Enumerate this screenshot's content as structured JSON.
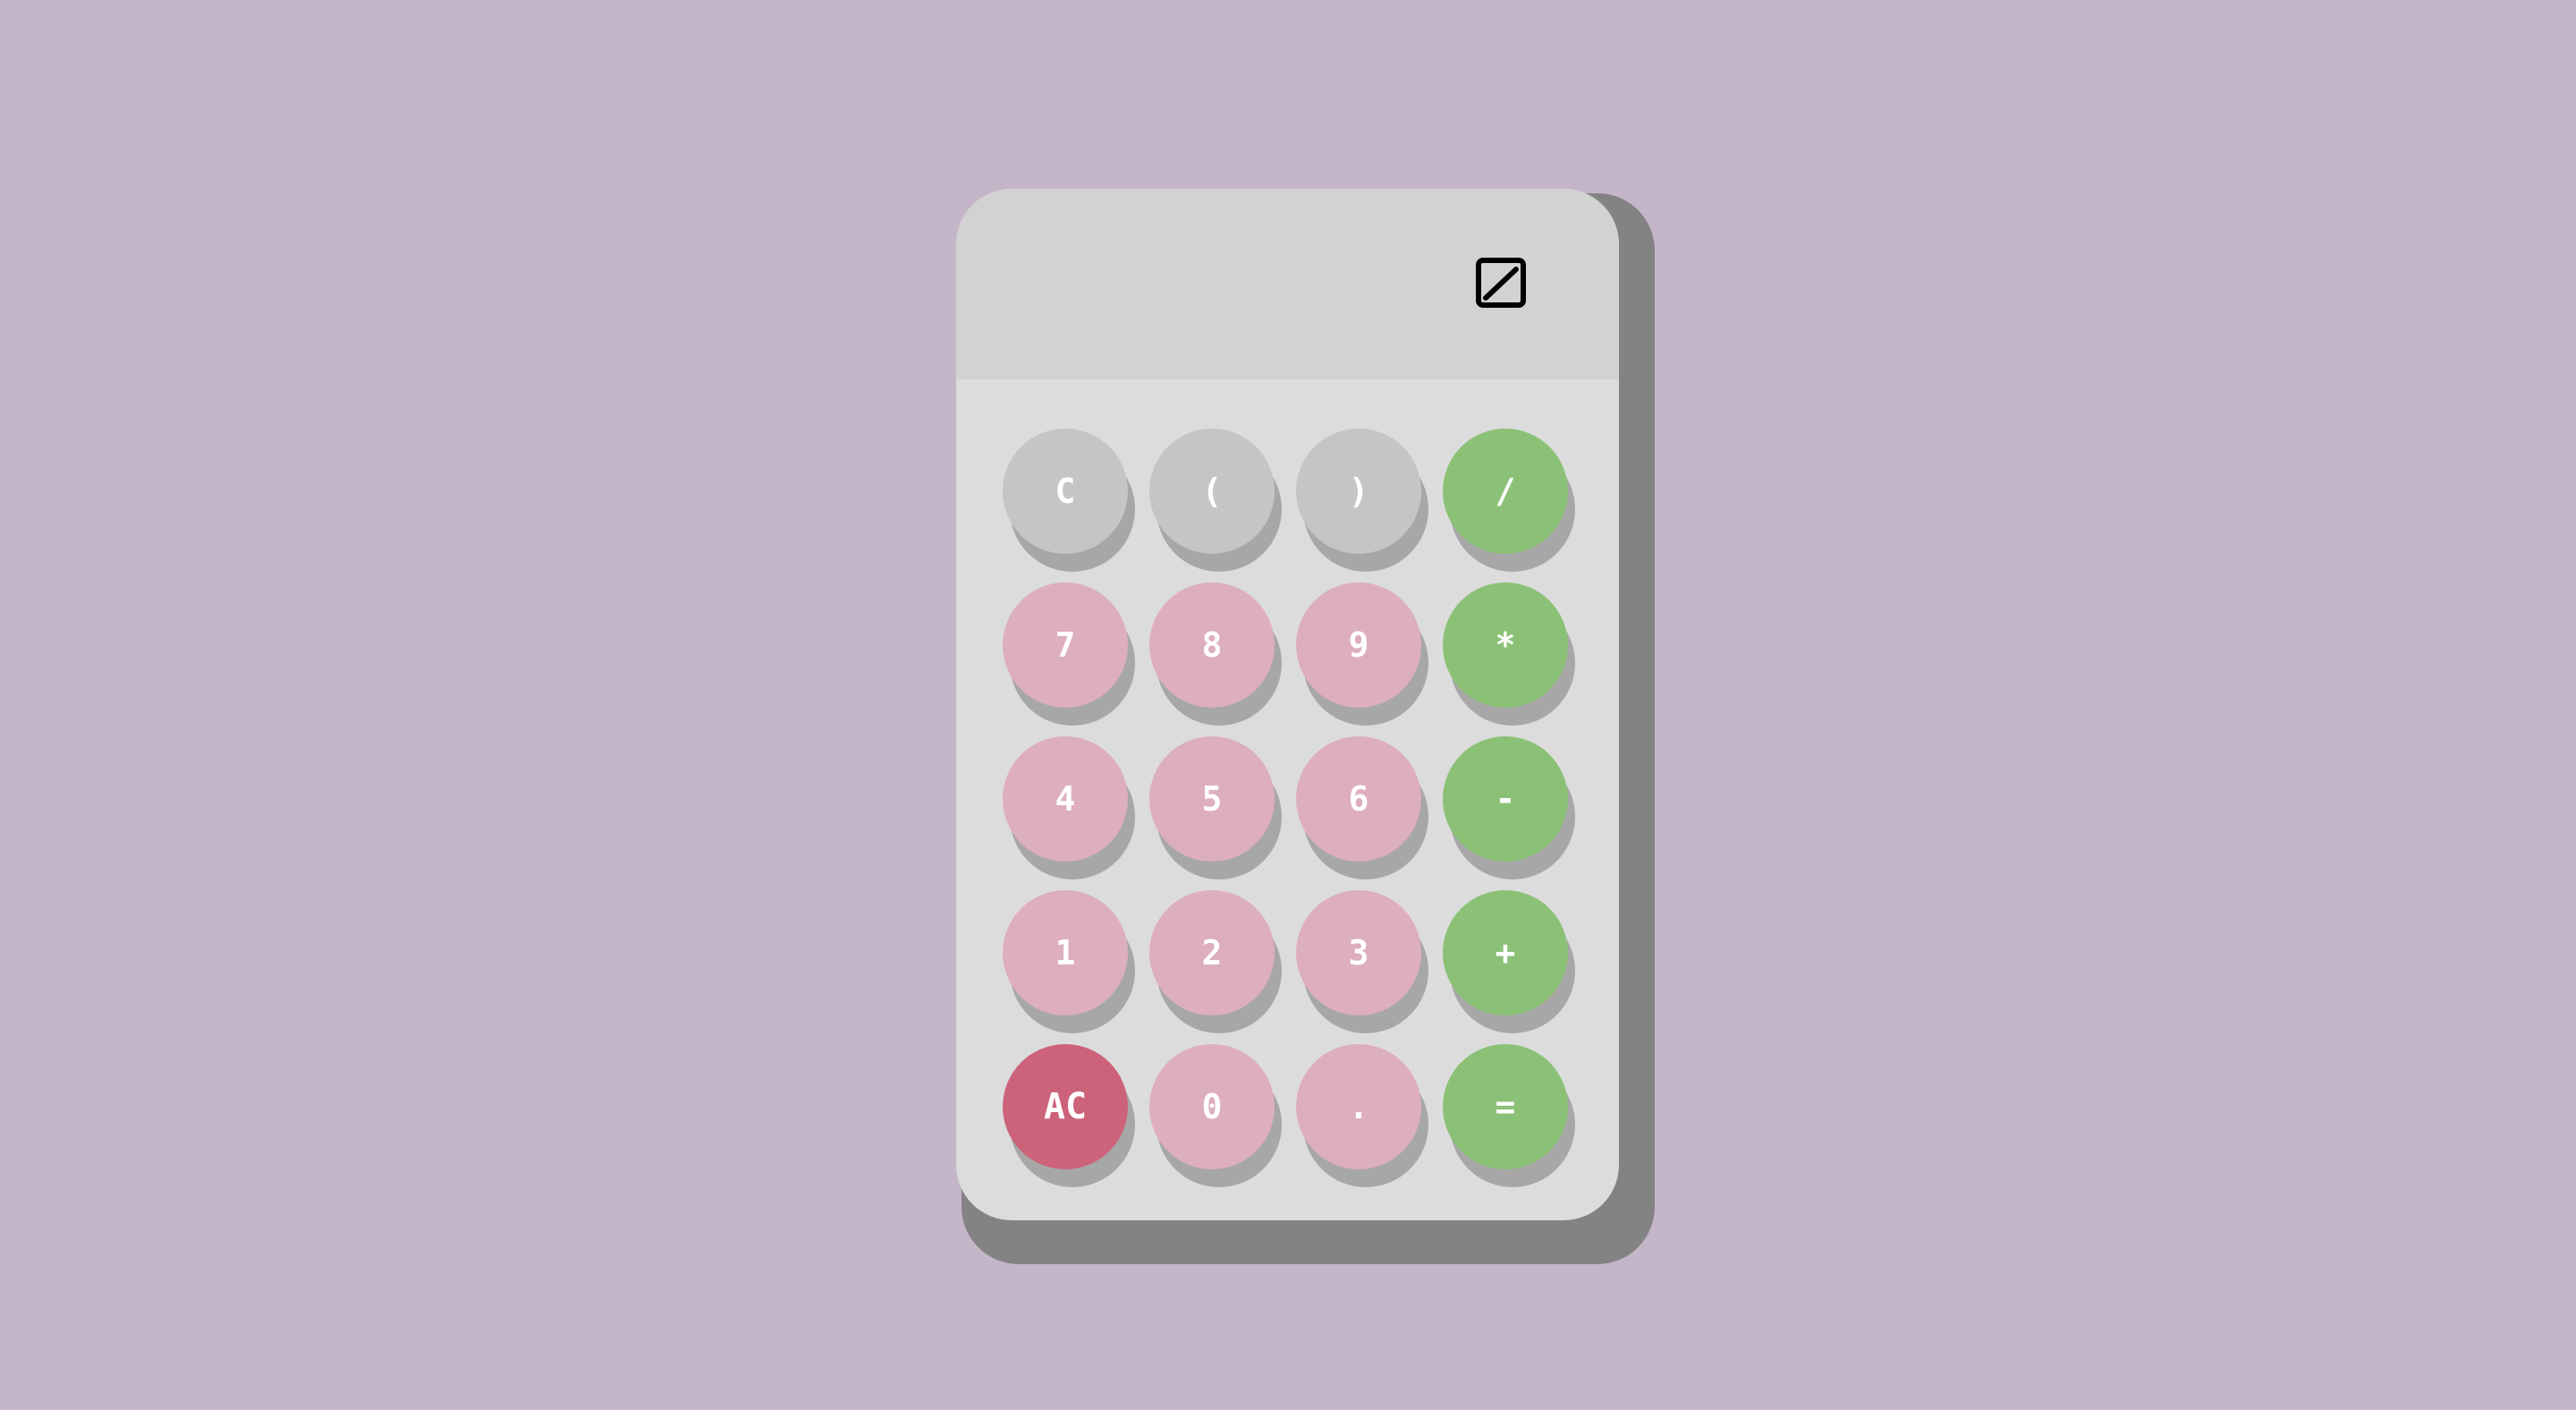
{
  "calculator": {
    "display_value": "",
    "display_icon": "slashed-zero-icon",
    "colors": {
      "background": "#c5b5c8",
      "body": "#dcdcdd",
      "display": "#d2d2d2",
      "utility_key": "#c6c4c6",
      "digit_key": "#ddaebe",
      "operator_key": "#8bc176",
      "clear_all_key": "#cc637a",
      "key_shadow": "#a7a7a7",
      "body_shadow": "#838383"
    },
    "keys": [
      {
        "label": "C",
        "name": "clear-button",
        "style": "gray"
      },
      {
        "label": "(",
        "name": "open-paren-button",
        "style": "gray"
      },
      {
        "label": ")",
        "name": "close-paren-button",
        "style": "gray"
      },
      {
        "label": "/",
        "name": "divide-button",
        "style": "green"
      },
      {
        "label": "7",
        "name": "digit-7-button",
        "style": "pink"
      },
      {
        "label": "8",
        "name": "digit-8-button",
        "style": "pink"
      },
      {
        "label": "9",
        "name": "digit-9-button",
        "style": "pink"
      },
      {
        "label": "*",
        "name": "multiply-button",
        "style": "green"
      },
      {
        "label": "4",
        "name": "digit-4-button",
        "style": "pink"
      },
      {
        "label": "5",
        "name": "digit-5-button",
        "style": "pink"
      },
      {
        "label": "6",
        "name": "digit-6-button",
        "style": "pink"
      },
      {
        "label": "-",
        "name": "subtract-button",
        "style": "green"
      },
      {
        "label": "1",
        "name": "digit-1-button",
        "style": "pink"
      },
      {
        "label": "2",
        "name": "digit-2-button",
        "style": "pink"
      },
      {
        "label": "3",
        "name": "digit-3-button",
        "style": "pink"
      },
      {
        "label": "+",
        "name": "add-button",
        "style": "green"
      },
      {
        "label": "AC",
        "name": "all-clear-button",
        "style": "red"
      },
      {
        "label": "0",
        "name": "digit-0-button",
        "style": "pink"
      },
      {
        "label": ".",
        "name": "decimal-button",
        "style": "pink"
      },
      {
        "label": "=",
        "name": "equals-button",
        "style": "green"
      }
    ]
  }
}
